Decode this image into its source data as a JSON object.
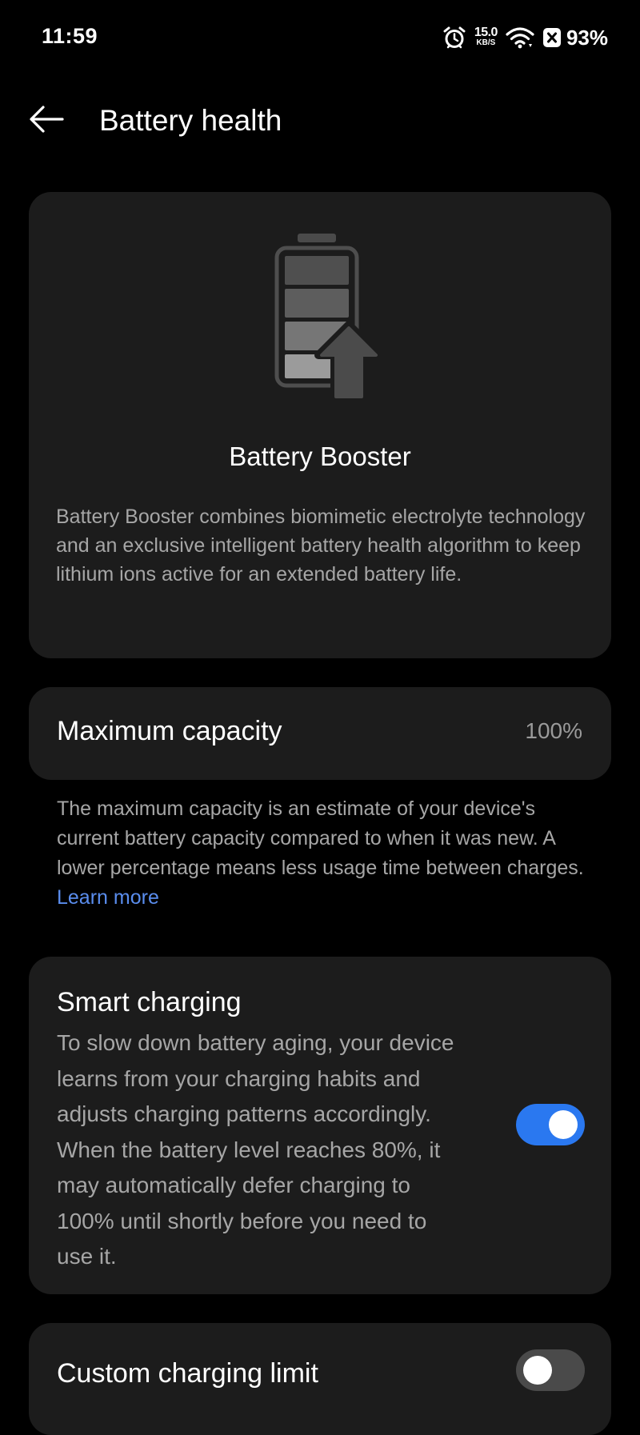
{
  "status_bar": {
    "time": "11:59",
    "net_speed_value": "15.0",
    "net_speed_unit": "KB/S",
    "battery_percent": "93%"
  },
  "header": {
    "title": "Battery health"
  },
  "booster": {
    "title": "Battery Booster",
    "description": "Battery Booster combines biomimetic electrolyte technology and an exclusive intelligent battery health algorithm to keep lithium ions active for an extended battery life."
  },
  "capacity": {
    "label": "Maximum capacity",
    "value": "100%",
    "note": "The maximum capacity is an estimate of your device's current battery capacity compared to when it was new. A lower percentage means less usage time between charges.",
    "learn_more": "Learn more"
  },
  "smart_charging": {
    "title": "Smart charging",
    "description": "To slow down battery aging, your device learns from your charging habits and adjusts charging patterns accordingly. When the battery level reaches 80%, it may automatically defer charging to 100% until shortly before you need to use it.",
    "enabled": true
  },
  "custom_limit": {
    "title": "Custom charging limit",
    "enabled": false
  },
  "colors": {
    "background": "#000000",
    "card": "#1c1c1c",
    "accent": "#2a78f0",
    "link": "#5a8dee",
    "secondary_text": "#a6a6a6"
  },
  "icons": {
    "status": [
      "alarm-icon",
      "wifi-icon",
      "battery-saver-icon"
    ],
    "header": "back-arrow-icon",
    "illustration": "battery-booster-icon"
  }
}
